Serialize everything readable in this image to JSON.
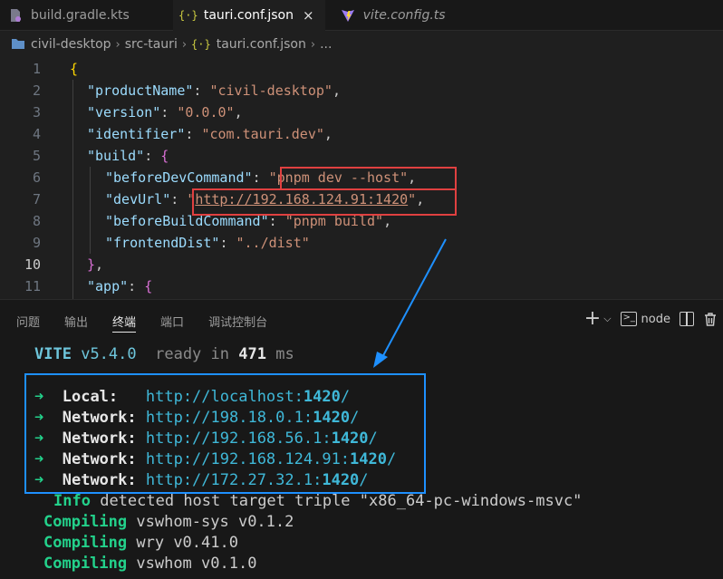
{
  "tabs": [
    {
      "label": "build.gradle.kts",
      "icon": "gradle-file-icon",
      "active": false
    },
    {
      "label": "tauri.conf.json",
      "icon": "json-braces-icon",
      "active": true,
      "close": "×"
    },
    {
      "label": "vite.config.ts",
      "icon": "vite-logo-icon",
      "active": false
    }
  ],
  "breadcrumb": {
    "items": [
      "civil-desktop",
      "src-tauri",
      "tauri.conf.json",
      "..."
    ]
  },
  "editor": {
    "line_numbers": [
      "1",
      "2",
      "3",
      "4",
      "5",
      "6",
      "7",
      "8",
      "9",
      "10",
      "11"
    ],
    "current_line": "10",
    "lines": {
      "l1_open": "{",
      "l2_key": "\"productName\"",
      "l2_val": "\"civil-desktop\"",
      "l3_key": "\"version\"",
      "l3_val": "\"0.0.0\"",
      "l4_key": "\"identifier\"",
      "l4_val": "\"com.tauri.dev\"",
      "l5_key": "\"build\"",
      "l5_open": "{",
      "l6_key": "\"beforeDevCommand\"",
      "l6_val": "\"pnpm dev --host\"",
      "l7_key": "\"devUrl\"",
      "l7_q1": "\"",
      "l7_url": "http://192.168.124.91:1420",
      "l7_q2": "\"",
      "l8_key": "\"beforeBuildCommand\"",
      "l8_val": "\"pnpm build\"",
      "l9_key": "\"frontendDist\"",
      "l9_val": "\"../dist\"",
      "l10_close": "}",
      "l11_key": "\"app\"",
      "l11_open": "{"
    }
  },
  "panel": {
    "tabs": [
      "问题",
      "输出",
      "终端",
      "端口",
      "调试控制台"
    ],
    "active_tab": "终端",
    "shell_label": "node"
  },
  "terminal": {
    "vite_name": "VITE",
    "vite_version": "v5.4.0",
    "ready_text": "ready in",
    "ready_ms": "471",
    "ms_unit": "ms",
    "arrow": "➜",
    "servers": [
      {
        "label": "Local:  ",
        "url_prefix": "http://localhost:",
        "port": "1420",
        "suffix": "/"
      },
      {
        "label": "Network:",
        "url_prefix": "http://198.18.0.1:",
        "port": "1420",
        "suffix": "/"
      },
      {
        "label": "Network:",
        "url_prefix": "http://192.168.56.1:",
        "port": "1420",
        "suffix": "/"
      },
      {
        "label": "Network:",
        "url_prefix": "http://192.168.124.91:",
        "port": "1420",
        "suffix": "/"
      },
      {
        "label": "Network:",
        "url_prefix": "http://172.27.32.1:",
        "port": "1420",
        "suffix": "/"
      }
    ],
    "info_label": "Info",
    "info_text": "detected host target triple \"x86_64-pc-windows-msvc\"",
    "compiling_label": "Compiling",
    "compiling": [
      "vswhom-sys v0.1.2",
      "wry v0.41.0",
      "vswhom v0.1.0"
    ]
  },
  "colors": {
    "annotation_red": "#e04040",
    "annotation_blue": "#1e90ff"
  }
}
